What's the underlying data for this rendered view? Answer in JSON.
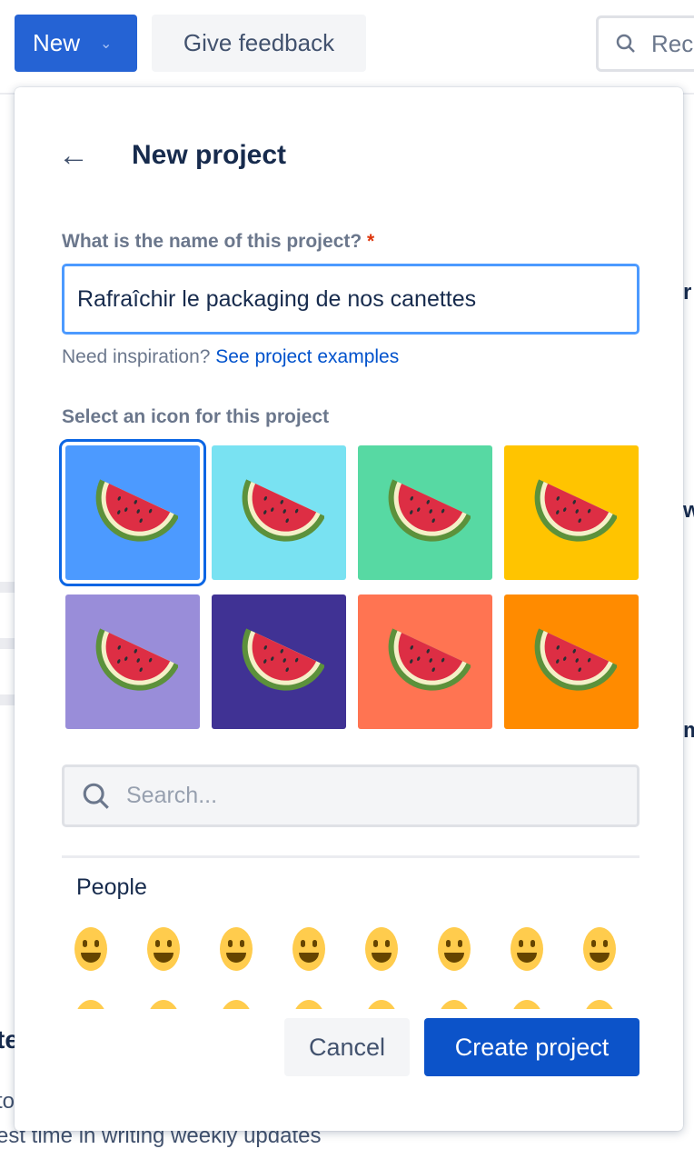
{
  "topbar": {
    "new_label": "New",
    "feedback_label": "Give feedback",
    "search_partial": "Rec"
  },
  "background": {
    "text_1": "te",
    "text_2": "to",
    "text_3": "est time in writing weekly updates",
    "edge_1": "r",
    "edge_2": "w",
    "edge_3": "m"
  },
  "dialog": {
    "title": "New project",
    "name_label": "What is the name of this project?",
    "required_mark": "*",
    "name_value": "Rafraîchir le packaging de nos canettes",
    "inspiration_text": "Need inspiration?",
    "inspiration_link": "See project examples",
    "icon_label": "Select an icon for this project",
    "icon_emoji": "watermelon",
    "icon_colors": [
      "#4c9aff",
      "#79e2f2",
      "#57d9a3",
      "#ffc400",
      "#998dd9",
      "#403294",
      "#ff7452",
      "#ff8b00"
    ],
    "selected_index": 0,
    "search_placeholder": "Search...",
    "category": "People",
    "emojis": [
      "grinning",
      "smiley",
      "smile",
      "grin",
      "laughing",
      "sweat_smile",
      "joy",
      "rofl"
    ],
    "cancel_label": "Cancel",
    "create_label": "Create project"
  }
}
